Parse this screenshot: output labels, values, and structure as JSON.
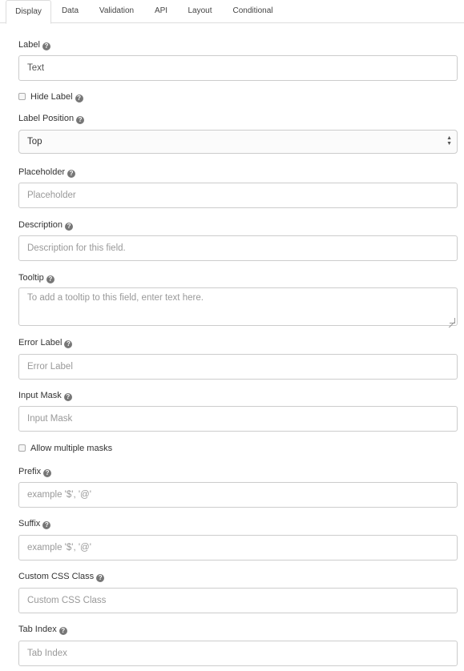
{
  "tabs": [
    "Display",
    "Data",
    "Validation",
    "API",
    "Layout",
    "Conditional"
  ],
  "help_glyph": "?",
  "fields": {
    "label": {
      "label": "Label",
      "value": "Text"
    },
    "hide_label": {
      "label": "Hide Label"
    },
    "label_position": {
      "label": "Label Position",
      "value": "Top"
    },
    "placeholder": {
      "label": "Placeholder",
      "placeholder": "Placeholder"
    },
    "description": {
      "label": "Description",
      "placeholder": "Description for this field."
    },
    "tooltip": {
      "label": "Tooltip",
      "placeholder": "To add a tooltip to this field, enter text here."
    },
    "error_label": {
      "label": "Error Label",
      "placeholder": "Error Label"
    },
    "input_mask": {
      "label": "Input Mask",
      "placeholder": "Input Mask"
    },
    "allow_multiple_masks": {
      "label": "Allow multiple masks"
    },
    "prefix": {
      "label": "Prefix",
      "placeholder": "example '$', '@'"
    },
    "suffix": {
      "label": "Suffix",
      "placeholder": "example '$', '@'"
    },
    "custom_css": {
      "label": "Custom CSS Class",
      "placeholder": "Custom CSS Class"
    },
    "tab_index": {
      "label": "Tab Index",
      "placeholder": "Tab Index"
    }
  },
  "icons": {
    "help": "question-circle-icon",
    "select_arrows": "up-down-arrows-icon",
    "resize": "resize-handle-icon"
  }
}
